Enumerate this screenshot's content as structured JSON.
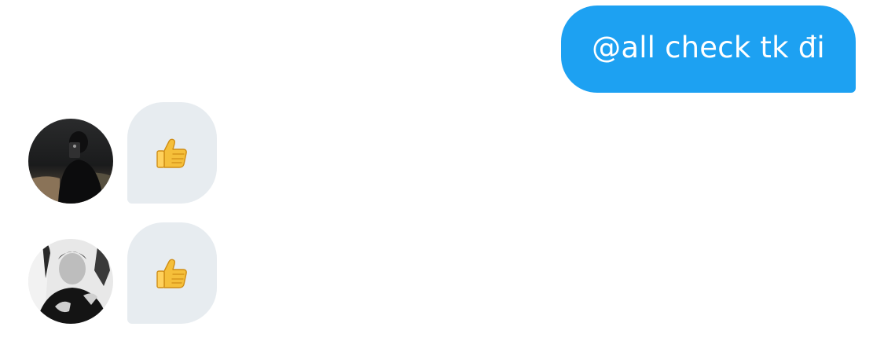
{
  "conversation": {
    "outgoing": [
      {
        "text": "@all check tk đi",
        "color": "#1DA1F2"
      }
    ],
    "incoming": [
      {
        "avatar": "avatar-user-1",
        "reaction_icon": "thumbs-up-icon",
        "bubble_color": "#E7ECF0"
      },
      {
        "avatar": "avatar-user-2",
        "reaction_icon": "thumbs-up-icon",
        "bubble_color": "#E7ECF0"
      }
    ]
  }
}
